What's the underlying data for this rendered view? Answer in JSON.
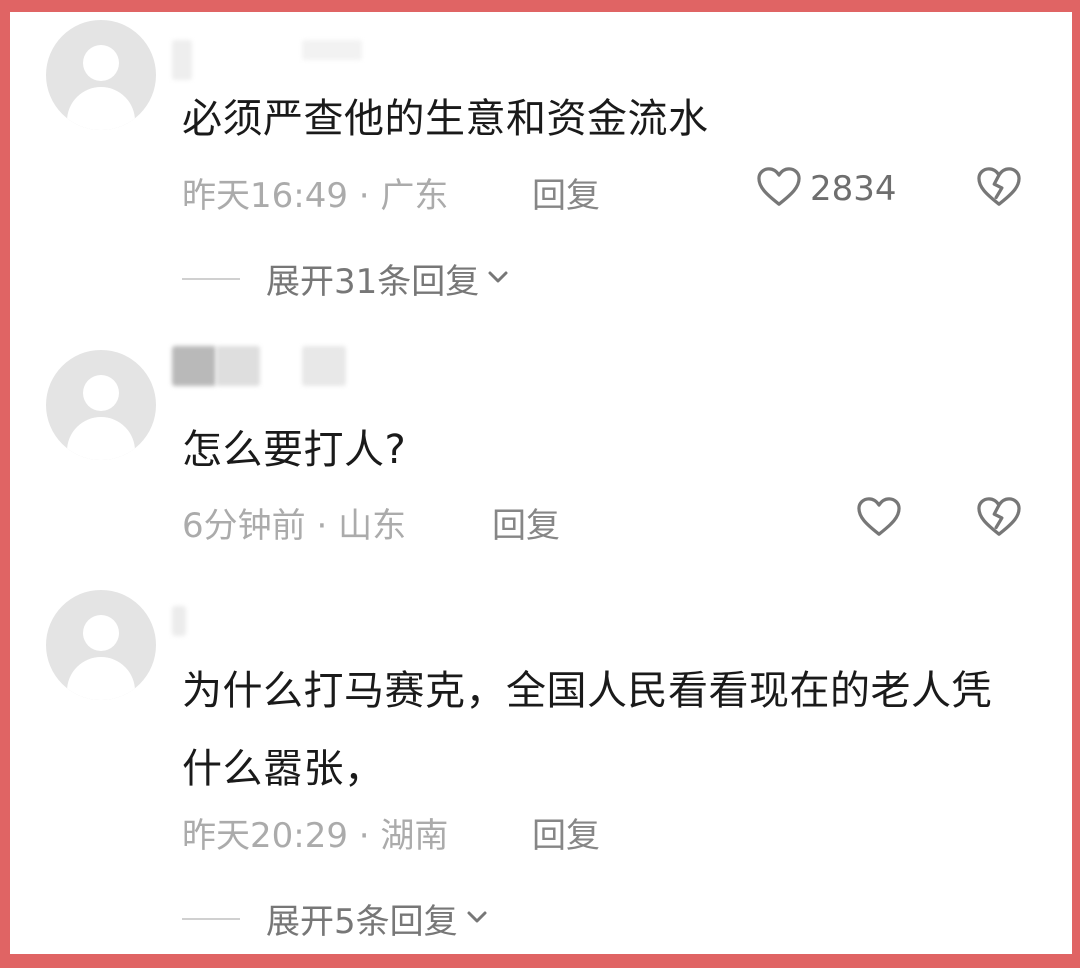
{
  "comments": [
    {
      "text": "必须严查他的生意和资金流水",
      "time": "昨天16:49",
      "separator": " · ",
      "location": "广东",
      "reply_label": "回复",
      "like_count": "2834",
      "expand_label": "展开31条回复"
    },
    {
      "text": "怎么要打人?",
      "time": "6分钟前",
      "separator": " · ",
      "location": "山东",
      "reply_label": "回复",
      "like_count": ""
    },
    {
      "text": "为什么打马赛克，全国人民看看现在的老人凭什么嚣张，",
      "time": "昨天20:29",
      "separator": " · ",
      "location": "湖南",
      "reply_label": "回复",
      "expand_label": "展开5条回复"
    }
  ],
  "colors": {
    "frame": "#e06464",
    "text": "#1a1a1a",
    "meta": "#ababab",
    "icon": "#777777"
  },
  "icons": {
    "like": "heart-outline-icon",
    "dislike": "broken-heart-icon",
    "expand": "chevron-down-icon",
    "avatar": "default-avatar-icon"
  }
}
